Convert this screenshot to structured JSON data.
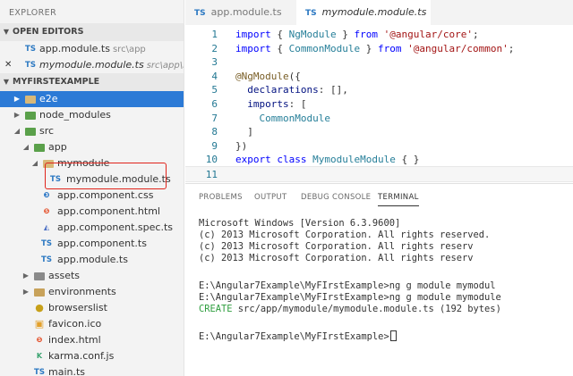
{
  "sidebar": {
    "title": "EXPLORER",
    "open_editors": {
      "header": "OPEN EDITORS",
      "items": [
        {
          "icon": "TS",
          "label": "app.module.ts",
          "path": "src\\app"
        },
        {
          "icon": "TS",
          "label": "mymodule.module.ts",
          "path": "src\\app\\my..."
        }
      ]
    },
    "project": {
      "header": "MYFIRSTEXAMPLE",
      "items": [
        {
          "label": "e2e"
        },
        {
          "label": "node_modules"
        },
        {
          "label": "src"
        },
        {
          "label": "app"
        },
        {
          "label": "mymodule"
        },
        {
          "icon": "TS",
          "label": "mymodule.module.ts"
        },
        {
          "label": "app.component.css"
        },
        {
          "label": "app.component.html"
        },
        {
          "label": "app.component.spec.ts"
        },
        {
          "icon": "TS",
          "label": "app.component.ts"
        },
        {
          "icon": "TS",
          "label": "app.module.ts"
        },
        {
          "label": "assets"
        },
        {
          "label": "environments"
        },
        {
          "label": "browserslist"
        },
        {
          "label": "favicon.ico"
        },
        {
          "label": "index.html"
        },
        {
          "label": "karma.conf.js"
        },
        {
          "label": "main.ts"
        }
      ]
    }
  },
  "tabs": [
    {
      "icon": "TS",
      "label": "app.module.ts"
    },
    {
      "icon": "TS",
      "label": "mymodule.module.ts",
      "close": "×"
    }
  ],
  "editor": {
    "lines": [
      {
        "n": "1",
        "parts": [
          [
            "k",
            "import"
          ],
          [
            "p",
            " { "
          ],
          [
            "c",
            "NgModule"
          ],
          [
            "p",
            " } "
          ],
          [
            "k",
            "from"
          ],
          [
            "p",
            " "
          ],
          [
            "s",
            "'@angular/core'"
          ],
          [
            "p",
            ";"
          ]
        ]
      },
      {
        "n": "2",
        "parts": [
          [
            "k",
            "import"
          ],
          [
            "p",
            " { "
          ],
          [
            "c",
            "CommonModule"
          ],
          [
            "p",
            " } "
          ],
          [
            "k",
            "from"
          ],
          [
            "p",
            " "
          ],
          [
            "s",
            "'@angular/common'"
          ],
          [
            "p",
            ";"
          ]
        ]
      },
      {
        "n": "3",
        "parts": []
      },
      {
        "n": "4",
        "parts": [
          [
            "m",
            "@NgModule"
          ],
          [
            "p",
            "({"
          ]
        ]
      },
      {
        "n": "5",
        "parts": [
          [
            "p",
            "  "
          ],
          [
            "d",
            "declarations"
          ],
          [
            "p",
            ": [],"
          ]
        ]
      },
      {
        "n": "6",
        "parts": [
          [
            "p",
            "  "
          ],
          [
            "d",
            "imports"
          ],
          [
            "p",
            ": ["
          ]
        ]
      },
      {
        "n": "7",
        "parts": [
          [
            "p",
            "    "
          ],
          [
            "c",
            "CommonModule"
          ]
        ]
      },
      {
        "n": "8",
        "parts": [
          [
            "p",
            "  ]"
          ]
        ]
      },
      {
        "n": "9",
        "parts": [
          [
            "p",
            "})"
          ]
        ]
      },
      {
        "n": "10",
        "parts": [
          [
            "k",
            "export"
          ],
          [
            "p",
            " "
          ],
          [
            "k",
            "class"
          ],
          [
            "p",
            " "
          ],
          [
            "c",
            "MymoduleModule"
          ],
          [
            "p",
            " { }"
          ]
        ]
      },
      {
        "n": "11",
        "parts": []
      }
    ]
  },
  "panel": {
    "tabs": [
      "PROBLEMS",
      "OUTPUT",
      "DEBUG CONSOLE",
      "TERMINAL"
    ],
    "active_tab": "TERMINAL",
    "terminal_lines": [
      "Microsoft Windows [Version 6.3.9600]",
      "(c) 2013 Microsoft Corporation. All rights reserved.",
      "(c) 2013 Microsoft Corporation. All rights reserv",
      "(c) 2013 Microsoft Corporation. All rights reserv",
      "",
      "E:\\Angular7Example\\MyFIrstExample>ng g module mymodul",
      "E:\\Angular7Example\\MyFIrstExample>ng g module mymodule",
      "CREATE src/app/mymodule/mymodule.module.ts (192 bytes)",
      "",
      "E:\\Angular7Example\\MyFIrstExample>"
    ],
    "create_word": "CREATE",
    "create_rest": " src/app/mymodule/mymodule.module.ts (192 bytes)"
  },
  "colors": {
    "selection": "#2c7ad6",
    "highlight_box": "#e0241b",
    "ts_icon": "#2b78c2"
  }
}
